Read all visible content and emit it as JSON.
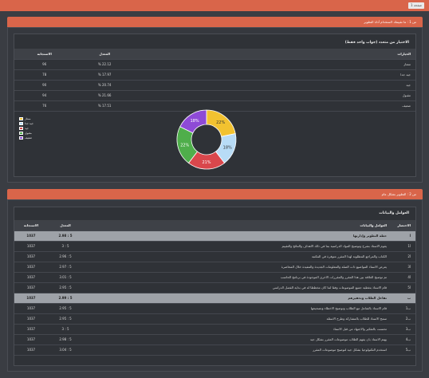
{
  "top_bar": {
    "page_label": "صفحة 1"
  },
  "question1": {
    "header": "س 1 : ما تقييمك لاستخدام أداة التطوير",
    "card_title": "الاختيار من متعدد (جواب واحد فقط)",
    "columns": {
      "option": "الخيارات",
      "percent": "المعدل",
      "responses": "الاستجابة"
    },
    "rows": [
      {
        "option": "ممتاز",
        "percent": "22.12 %",
        "responses": "96"
      },
      {
        "option": "جيد جدا",
        "percent": "17.97 %",
        "responses": "78"
      },
      {
        "option": "جيد",
        "percent": "20.74 %",
        "responses": "90"
      },
      {
        "option": "مقبول",
        "percent": "21.66 %",
        "responses": "94"
      },
      {
        "option": "ضعيف",
        "percent": "17.51 %",
        "responses": "76"
      }
    ]
  },
  "chart_data": {
    "type": "pie",
    "donut": true,
    "categories": [
      "ممتاز",
      "جيد جدا",
      "جيد",
      "مقبول",
      "ضعيف"
    ],
    "values": [
      22,
      18,
      21,
      22,
      18
    ],
    "labels": [
      "22%",
      "18%",
      "21%",
      "22%",
      "18%"
    ],
    "colors": [
      "#f2c230",
      "#b8dcf6",
      "#d9474c",
      "#4fae4b",
      "#8e4ad6"
    ],
    "legend_position": "left"
  },
  "question2": {
    "header": "س 2 : التطوير بشكل عام",
    "card_title": "العوامل والبيانات",
    "columns": {
      "code": "الاختصار",
      "item": "العوامل والبيانات",
      "score": "المعدل",
      "responses": "الاستجابة"
    },
    "rows": [
      {
        "code": "أ",
        "item": "خطة التطوير وإدارتها",
        "score": "5 : 2.98",
        "responses": "1037",
        "group": true
      },
      {
        "code": "أ1",
        "item": "يقوم الاستاذ بشرح وتوضيح المواد الدراسية بما في ذلك الاهداف والنتائج والتقييم",
        "score": "5 : 3",
        "responses": "1037",
        "group": false
      },
      {
        "code": "أ2",
        "item": "الكتاب والمراجع المطلوبة لهذا المقرر متوفرة في المكتبة",
        "score": "5 : 2.96",
        "responses": "1037",
        "group": false
      },
      {
        "code": "أ3",
        "item": "يعرض الاستاذ المواضيع ذات الصلة والمعلومات الجديدة والمفيدة خلال المحاضرة",
        "score": "5 : 2.97",
        "responses": "1037",
        "group": false
      },
      {
        "code": "أ4",
        "item": "تم توضيح العلاقة بين هذا المقرر والمقررات الاخرى الموجودة في برنامج الحاسب",
        "score": "5 : 3.01",
        "responses": "1037",
        "group": false
      },
      {
        "code": "أ5",
        "item": "قام الاستاذ بتغطية جميع الموضوعات وفقا لما كان مخططا له في بداية الفصل الدراسي",
        "score": "5 : 2.95",
        "responses": "1037",
        "group": false
      },
      {
        "code": "ب",
        "item": "تفاعل الطلاب وتحفيزهم",
        "score": "5 : 2.99",
        "responses": "1037",
        "group": true
      },
      {
        "code": "ب1",
        "item": "قام الاستاذ بالتفاعل مع الطلاب وتوضيح الاخطاء وتصحيحها",
        "score": "5 : 2.95",
        "responses": "1037",
        "group": false
      },
      {
        "code": "ب2",
        "item": "سمح الاستاذ للطلاب بالمشاركة وطرح الاسئلة",
        "score": "5 : 2.95",
        "responses": "1037",
        "group": false
      },
      {
        "code": "ب3",
        "item": "تحسنت بالتفكير والاجتهاد من قبل الاستاذ",
        "score": "5 : 3",
        "responses": "1037",
        "group": false
      },
      {
        "code": "ب4",
        "item": "يهتم الاستاذ بان يفهم الطلاب موضوعات المقرر بشكل جيد",
        "score": "5 : 2.98",
        "responses": "1037",
        "group": false
      },
      {
        "code": "ب5",
        "item": "استخدم التكنولوجيا بشكل جيد لتوضيح موضوعات المقرر",
        "score": "5 : 3.04",
        "responses": "1037",
        "group": false
      }
    ]
  }
}
